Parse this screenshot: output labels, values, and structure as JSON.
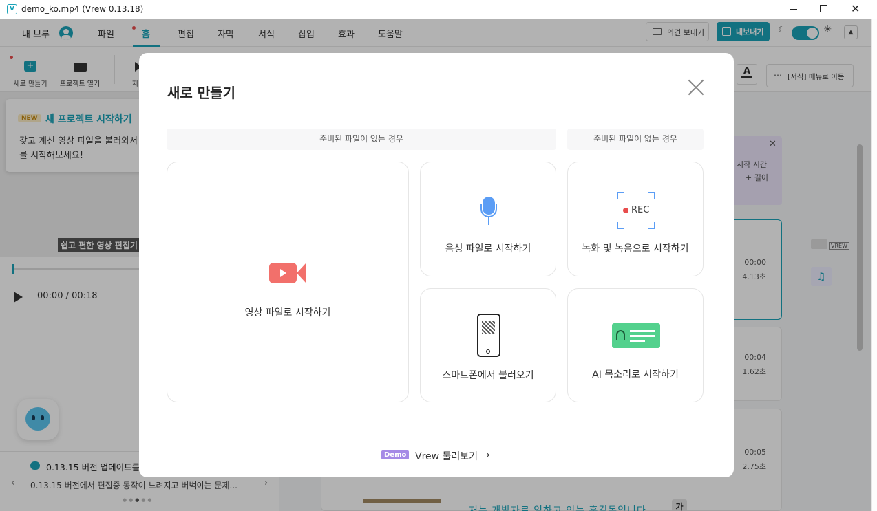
{
  "window": {
    "title": "demo_ko.mp4 (Vrew 0.13.18)",
    "app_icon": "V"
  },
  "menubar": {
    "profile": "내 브루",
    "items": [
      "파일",
      "홈",
      "편집",
      "자막",
      "서식",
      "삽입",
      "효과",
      "도움말"
    ],
    "active": "홈",
    "feedback": "의견 보내기",
    "export": "내보내기"
  },
  "toolbar": {
    "new_project": "새로 만들기",
    "open_project": "프로젝트 열기",
    "partial": "재",
    "format_menu": "[서식] 메뉴로 이동",
    "font_icon_letter": "A"
  },
  "tooltip": {
    "badge": "NEW",
    "title": "새 프로젝트 시작하기",
    "line1": "갖고 계신 영상 파일을 불러와서",
    "line2": "를 시작해보세요!"
  },
  "player": {
    "caption": "쉽고 편한 영상 편집기",
    "time": "00:00 / 00:18"
  },
  "news": {
    "title": "0.13.15 버전 업데이트를",
    "body": "0.13.15 버전에서 편집중 동작이 느려지고 버벅이는 문제..."
  },
  "right_panel": {
    "hint_line1": "시작 시간",
    "hint_line2": "+ 길이",
    "clips": [
      {
        "start": "00:00",
        "length": "4.13초"
      },
      {
        "start": "00:04",
        "length": "1.62초"
      },
      {
        "start": "00:05",
        "length": "2.75초"
      }
    ],
    "subtitle": "저는 개발자로 일하고 있는 홍길동입니다",
    "ga_button": "가",
    "vrew_badge": "VREW"
  },
  "modal": {
    "title": "새로 만들기",
    "section_with_file": "준비된 파일이 있는 경우",
    "section_without_file": "준비된 파일이 없는 경우",
    "options": {
      "video": "영상 파일로 시작하기",
      "audio": "음성 파일로 시작하기",
      "record": "녹화 및 녹음으로 시작하기",
      "rec_label": "REC",
      "smartphone": "스마트폰에서 불러오기",
      "ai_voice": "AI 목소리로 시작하기"
    },
    "demo_badge": "Demo",
    "demo_link": "Vrew 둘러보기"
  },
  "colors": {
    "accent": "#1aa3b8",
    "video_icon": "#f2706b",
    "mic_icon": "#5b9df5",
    "ai_icon": "#53d18d",
    "demo_badge": "#a58ae6",
    "rec_dot": "#e84c4c"
  }
}
